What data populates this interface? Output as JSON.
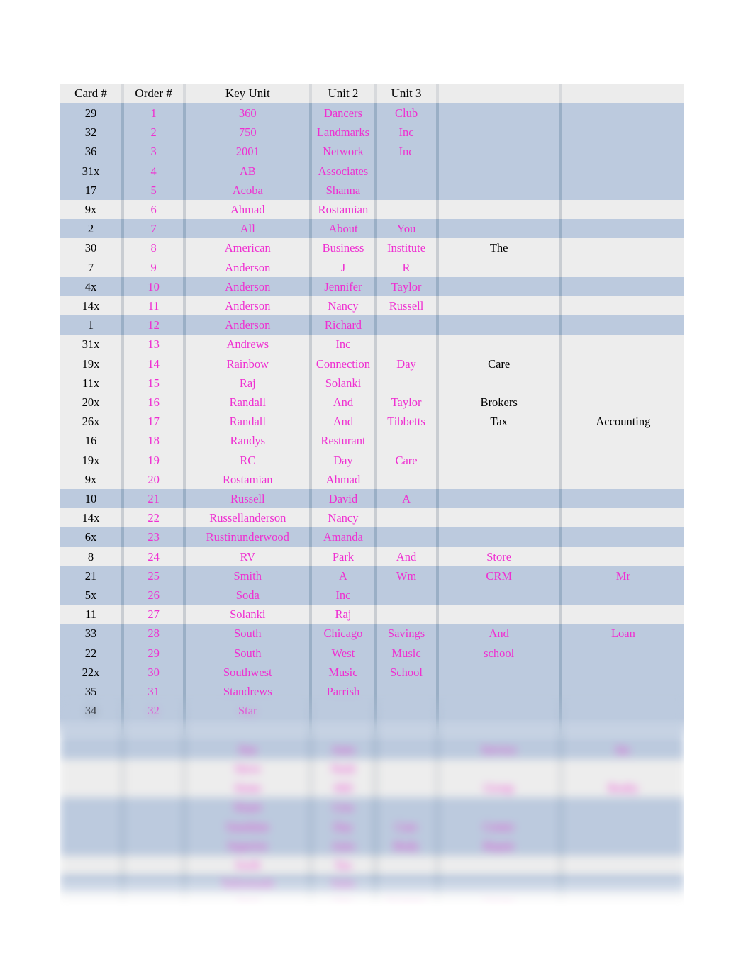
{
  "table": {
    "headers": [
      "Card #",
      "Order #",
      "Key Unit",
      "Unit 2",
      "Unit 3",
      "",
      ""
    ],
    "colors": {
      "header_text": "#000000",
      "card_text": "#000000",
      "pink_text": "#ef2fd1",
      "band_blue": "#bccade",
      "band_white": "#ededed",
      "gap_blue": "#9aafc6",
      "gap_white": "#c9cdd2"
    },
    "rows": [
      {
        "band": "blue",
        "card": "29",
        "order": "1",
        "key": "360",
        "u2": "Dancers",
        "u3": "Club",
        "u4": "",
        "u5": ""
      },
      {
        "band": "blue",
        "card": "32",
        "order": "2",
        "key": "750",
        "u2": "Landmarks",
        "u3": "Inc",
        "u4": "",
        "u5": ""
      },
      {
        "band": "blue",
        "card": "36",
        "order": "3",
        "key": "2001",
        "u2": "Network",
        "u3": "Inc",
        "u4": "",
        "u5": ""
      },
      {
        "band": "blue",
        "card": "31x",
        "order": "4",
        "key": "AB",
        "u2": "Associates",
        "u3": "",
        "u4": "",
        "u5": ""
      },
      {
        "band": "blue",
        "card": "17",
        "order": "5",
        "key": "Acoba",
        "u2": "Shanna",
        "u3": "",
        "u4": "",
        "u5": ""
      },
      {
        "band": "white",
        "card": "9x",
        "order": "6",
        "key": "Ahmad",
        "u2": "Rostamian",
        "u3": "",
        "u4": "",
        "u5": ""
      },
      {
        "band": "blue",
        "card": "2",
        "order": "7",
        "key": "All",
        "u2": "About",
        "u3": "You",
        "u4": "",
        "u5": ""
      },
      {
        "band": "white",
        "card": "30",
        "order": "8",
        "key": "American",
        "u2": "Business",
        "u3": "Institute",
        "u4": "The",
        "u5": ""
      },
      {
        "band": "white",
        "card": "7",
        "order": "9",
        "key": "Anderson",
        "u2": "J",
        "u3": "R",
        "u4": "",
        "u5": ""
      },
      {
        "band": "blue",
        "card": "4x",
        "order": "10",
        "key": "Anderson",
        "u2": "Jennifer",
        "u3": "Taylor",
        "u4": "",
        "u5": ""
      },
      {
        "band": "white",
        "card": "14x",
        "order": "11",
        "key": "Anderson",
        "u2": "Nancy",
        "u3": "Russell",
        "u4": "",
        "u5": ""
      },
      {
        "band": "blue",
        "card": "1",
        "order": "12",
        "key": "Anderson",
        "u2": "Richard",
        "u3": "",
        "u4": "",
        "u5": ""
      },
      {
        "band": "white",
        "card": "31x",
        "order": "13",
        "key": "Andrews",
        "u2": "Inc",
        "u3": "",
        "u4": "",
        "u5": ""
      },
      {
        "band": "white",
        "card": "19x",
        "order": "14",
        "key": "Rainbow",
        "u2": "Connection",
        "u3": "Day",
        "u4": "Care",
        "u5": ""
      },
      {
        "band": "white",
        "card": "11x",
        "order": "15",
        "key": "Raj",
        "u2": "Solanki",
        "u3": "",
        "u4": "",
        "u5": ""
      },
      {
        "band": "white",
        "card": "20x",
        "order": "16",
        "key": "Randall",
        "u2": "And",
        "u3": "Taylor",
        "u4": "Brokers",
        "u5": ""
      },
      {
        "band": "white",
        "card": "26x",
        "order": "17",
        "key": "Randall",
        "u2": "And",
        "u3": "Tibbetts",
        "u4": "Tax",
        "u5": "Accounting"
      },
      {
        "band": "white",
        "card": "16",
        "order": "18",
        "key": "Randys",
        "u2": "Resturant",
        "u3": "",
        "u4": "",
        "u5": ""
      },
      {
        "band": "white",
        "card": "19x",
        "order": "19",
        "key": "RC",
        "u2": "Day",
        "u3": "Care",
        "u4": "",
        "u5": ""
      },
      {
        "band": "white",
        "card": "9x",
        "order": "20",
        "key": "Rostamian",
        "u2": "Ahmad",
        "u3": "",
        "u4": "",
        "u5": ""
      },
      {
        "band": "blue",
        "card": "10",
        "order": "21",
        "key": "Russell",
        "u2": "David",
        "u3": "A",
        "u4": "",
        "u5": ""
      },
      {
        "band": "white",
        "card": "14x",
        "order": "22",
        "key": "Russellanderson",
        "u2": "Nancy",
        "u3": "",
        "u4": "",
        "u5": ""
      },
      {
        "band": "blue",
        "card": "6x",
        "order": "23",
        "key": "Rustinunderwood",
        "u2": "Amanda",
        "u3": "",
        "u4": "",
        "u5": ""
      },
      {
        "band": "white",
        "card": "8",
        "order": "24",
        "key": "RV",
        "u2": "Park",
        "u3": "And",
        "u4": "Store",
        "u5": ""
      },
      {
        "band": "blue",
        "card": "21",
        "order": "25",
        "key": "Smith",
        "u2": "A",
        "u3": "Wm",
        "u4": "CRM",
        "u5": "Mr"
      },
      {
        "band": "blue",
        "card": "5x",
        "order": "26",
        "key": "Soda",
        "u2": "Inc",
        "u3": "",
        "u4": "",
        "u5": ""
      },
      {
        "band": "white",
        "card": "11",
        "order": "27",
        "key": "Solanki",
        "u2": "Raj",
        "u3": "",
        "u4": "",
        "u5": ""
      },
      {
        "band": "blue",
        "card": "33",
        "order": "28",
        "key": "South",
        "u2": "Chicago",
        "u3": "Savings",
        "u4": "And",
        "u5": "Loan"
      },
      {
        "band": "blue",
        "card": "22",
        "order": "29",
        "key": "South",
        "u2": "West",
        "u3": "Music",
        "u4": "school",
        "u5": ""
      },
      {
        "band": "blue",
        "card": "22x",
        "order": "30",
        "key": "Southwest",
        "u2": "Music",
        "u3": "School",
        "u4": "",
        "u5": ""
      },
      {
        "band": "blue",
        "card": "35",
        "order": "31",
        "key": "Standrews",
        "u2": "Parrish",
        "u3": "",
        "u4": "",
        "u5": ""
      },
      {
        "band": "blue",
        "card": "34",
        "order": "32",
        "key": "Star",
        "u2": "",
        "u3": "",
        "u4": "",
        "u5": ""
      },
      {
        "band": "blue",
        "card": "",
        "order": "",
        "key": "",
        "u2": "",
        "u3": "",
        "u4": "",
        "u5": ""
      },
      {
        "band": "blue",
        "card": "",
        "order": "",
        "key": "Star",
        "u2": "Auto",
        "u3": "",
        "u4": "Service",
        "u5": "Inc"
      },
      {
        "band": "white",
        "card": "",
        "order": "",
        "key": "Steve",
        "u2": "Nash",
        "u3": "",
        "u4": "",
        "u5": ""
      },
      {
        "band": "white",
        "card": "",
        "order": "",
        "key": "Stone",
        "u2": "Hill",
        "u3": "",
        "u4": "Group",
        "u5": "Realty"
      },
      {
        "band": "blue",
        "card": "",
        "order": "",
        "key": "Stuart",
        "u2": "Lisa",
        "u3": "",
        "u4": "",
        "u5": ""
      },
      {
        "band": "blue",
        "card": "",
        "order": "",
        "key": "Sunshine",
        "u2": "Day",
        "u3": "Care",
        "u4": "Center",
        "u5": ""
      },
      {
        "band": "blue",
        "card": "",
        "order": "",
        "key": "Superior",
        "u2": "Auto",
        "u3": "Body",
        "u4": "Repair",
        "u5": ""
      },
      {
        "band": "white",
        "card": "",
        "order": "",
        "key": "Swift",
        "u2": "Tax",
        "u3": "",
        "u4": "",
        "u5": ""
      },
      {
        "band": "blue",
        "card": "",
        "order": "",
        "key": "Tailormade",
        "u2": "Suits",
        "u3": "",
        "u4": "",
        "u5": ""
      },
      {
        "band": "white",
        "card": "",
        "order": "",
        "key": "Tech",
        "u2": "One",
        "u3": "Systems",
        "u4": "Group",
        "u5": ""
      }
    ]
  }
}
